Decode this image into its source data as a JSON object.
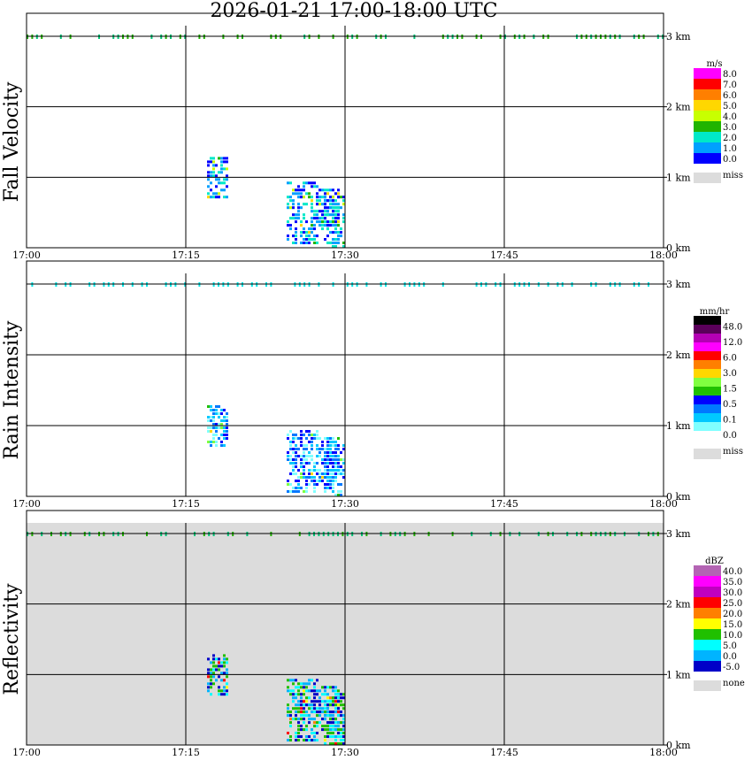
{
  "title": "2026-01-21   17:00-18:00 UTC",
  "x_ticks": [
    "17:00",
    "17:15",
    "17:30",
    "17:45",
    "18:00"
  ],
  "y_ticks": [
    "0 km",
    "1 km",
    "2 km",
    "3 km"
  ],
  "colors": {
    "missing": "#dcdcdc"
  },
  "chart_data": [
    {
      "type": "heatmap",
      "ylabel": "Fall Velocity",
      "xlabel": "",
      "xlim": [
        "17:00",
        "18:00"
      ],
      "ylim": [
        0,
        3
      ],
      "y_unit": "km",
      "grid": true,
      "background": "#ffffff",
      "legend": {
        "position": "right",
        "unit": "m/s",
        "labels": [
          "8.0",
          "7.0",
          "6.0",
          "5.0",
          "4.0",
          "3.0",
          "2.0",
          "1.0",
          "0.0"
        ],
        "colors": [
          "#ff00ff",
          "#ff0000",
          "#ff7f00",
          "#ffd700",
          "#c8ff00",
          "#20b400",
          "#00e8c8",
          "#00a0ff",
          "#0000ff"
        ],
        "missing_label": "miss"
      },
      "blobs": [
        {
          "t0": 17.0,
          "t1": 19.0,
          "h0": 0.7,
          "h1": 1.3
        },
        {
          "t0": 24.5,
          "t1": 27.5,
          "h0": 0.05,
          "h1": 0.95
        },
        {
          "t0": 27.5,
          "t1": 29.5,
          "h0": 0.2,
          "h1": 0.85
        },
        {
          "t0": 28.0,
          "t1": 29.8,
          "h0": 0.0,
          "h1": 0.75
        }
      ]
    },
    {
      "type": "heatmap",
      "ylabel": "Rain Intensity",
      "xlabel": "",
      "xlim": [
        "17:00",
        "18:00"
      ],
      "ylim": [
        0,
        3
      ],
      "y_unit": "km",
      "grid": true,
      "background": "#ffffff",
      "legend": {
        "position": "right",
        "unit": "mm/hr",
        "labels": [
          "48.0",
          "12.0",
          "6.0",
          "3.0",
          "1.5",
          "0.5",
          "0.1",
          "0.0"
        ],
        "colors": [
          "#000000",
          "#5a005a",
          "#b400b4",
          "#ff00ff",
          "#ff0000",
          "#ff7f00",
          "#ffd700",
          "#80ff40",
          "#20c000",
          "#0000ff",
          "#0078ff",
          "#00c8ff",
          "#80ffff",
          "#ffffff"
        ],
        "missing_label": "miss"
      },
      "blobs": [
        {
          "t0": 17.0,
          "t1": 19.0,
          "h0": 0.7,
          "h1": 1.3
        },
        {
          "t0": 24.5,
          "t1": 27.5,
          "h0": 0.05,
          "h1": 0.95
        },
        {
          "t0": 27.5,
          "t1": 29.5,
          "h0": 0.2,
          "h1": 0.85
        },
        {
          "t0": 28.0,
          "t1": 29.8,
          "h0": 0.0,
          "h1": 0.75
        }
      ]
    },
    {
      "type": "heatmap",
      "ylabel": "Reflectivity",
      "xlabel": "",
      "xlim": [
        "17:00",
        "18:00"
      ],
      "ylim": [
        0,
        3
      ],
      "y_unit": "km",
      "grid": true,
      "background": "#dcdcdc",
      "legend": {
        "position": "right",
        "unit": "dBZ",
        "labels": [
          "40.0",
          "35.0",
          "30.0",
          "25.0",
          "20.0",
          "15.0",
          "10.0",
          "5.0",
          "0.0",
          "-5.0"
        ],
        "colors": [
          "#b464b4",
          "#ff00ff",
          "#c000c0",
          "#ff0000",
          "#ff7f00",
          "#ffff00",
          "#20c000",
          "#00ffff",
          "#00b4ff",
          "#0000c8"
        ],
        "missing_label": "none"
      },
      "blobs": [
        {
          "t0": 17.0,
          "t1": 19.0,
          "h0": 0.7,
          "h1": 1.3
        },
        {
          "t0": 24.5,
          "t1": 27.5,
          "h0": 0.05,
          "h1": 0.95
        },
        {
          "t0": 27.5,
          "t1": 29.5,
          "h0": 0.2,
          "h1": 0.85
        },
        {
          "t0": 28.0,
          "t1": 29.8,
          "h0": 0.0,
          "h1": 0.75
        }
      ]
    }
  ]
}
